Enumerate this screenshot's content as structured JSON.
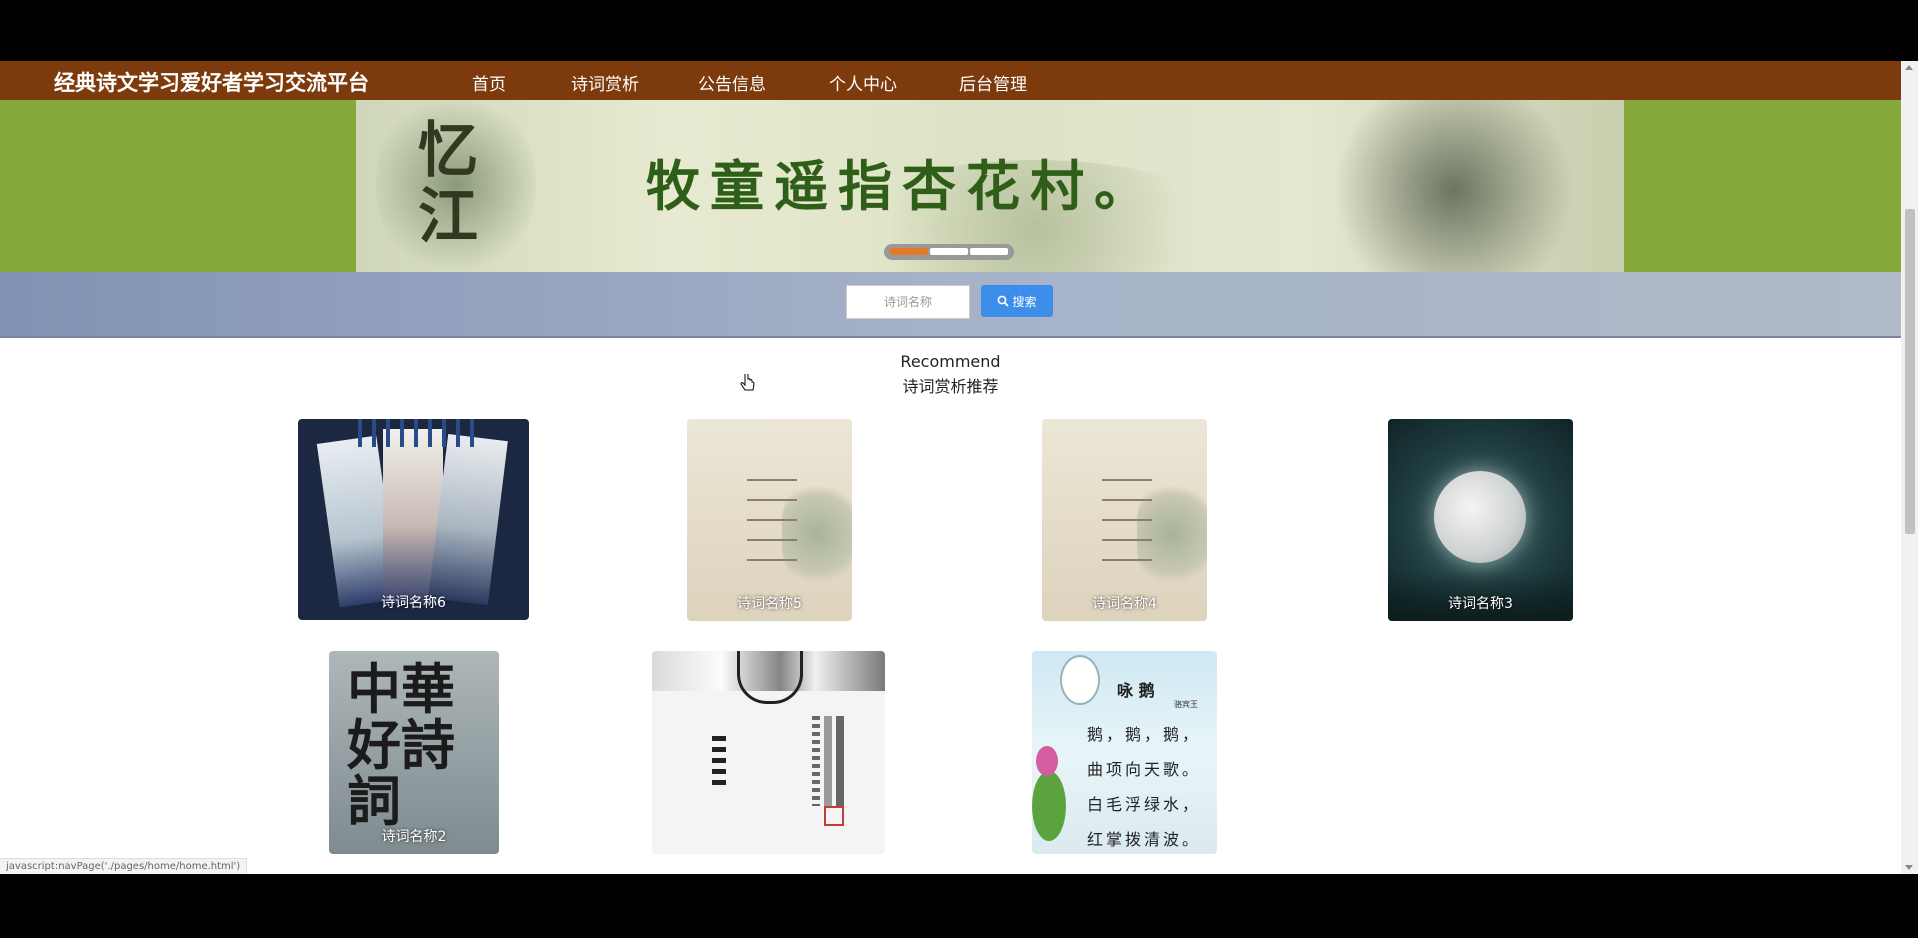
{
  "header": {
    "site_title": "经典诗文学习爱好者学习交流平台",
    "nav": [
      {
        "label": "首页"
      },
      {
        "label": "诗词赏析"
      },
      {
        "label": "公告信息"
      },
      {
        "label": "个人中心"
      },
      {
        "label": "后台管理"
      }
    ]
  },
  "banner": {
    "callig_text": "忆江",
    "poem_line": "牧童遥指杏花村。",
    "slides": 3,
    "active_slide": 1
  },
  "search": {
    "placeholder": "诗词名称",
    "button_label": "搜索"
  },
  "recommend": {
    "title_en": "Recommend",
    "title_cn": "诗词赏析推荐",
    "items": [
      {
        "caption": "诗词名称6",
        "art": "bookmarks"
      },
      {
        "caption": "诗词名称5",
        "art": "ink-landscape"
      },
      {
        "caption": "诗词名称4",
        "art": "ink-landscape"
      },
      {
        "caption": "诗词名称3",
        "art": "moon"
      },
      {
        "caption": "诗词名称2",
        "art": "calligraphy"
      },
      {
        "caption": "",
        "art": "ink-portrait"
      },
      {
        "caption": "",
        "art": "goose-poem"
      }
    ]
  },
  "goose_poem": {
    "title": "咏 鹅",
    "author": "骆宾王",
    "lines": [
      "鹅，鹅，鹅，",
      "曲项向天歌。",
      "白毛浮绿水，",
      "红掌拨清波。"
    ]
  },
  "calligraphy_card": {
    "chars": "中華好詩詞"
  },
  "status_bar": {
    "text": "javascript:navPage('./pages/home/home.html')"
  },
  "colors": {
    "navbar": "#7d3a0c",
    "banner_band": "#87a83a",
    "search_button": "#3d8eea",
    "active_dot": "#e47a25"
  }
}
